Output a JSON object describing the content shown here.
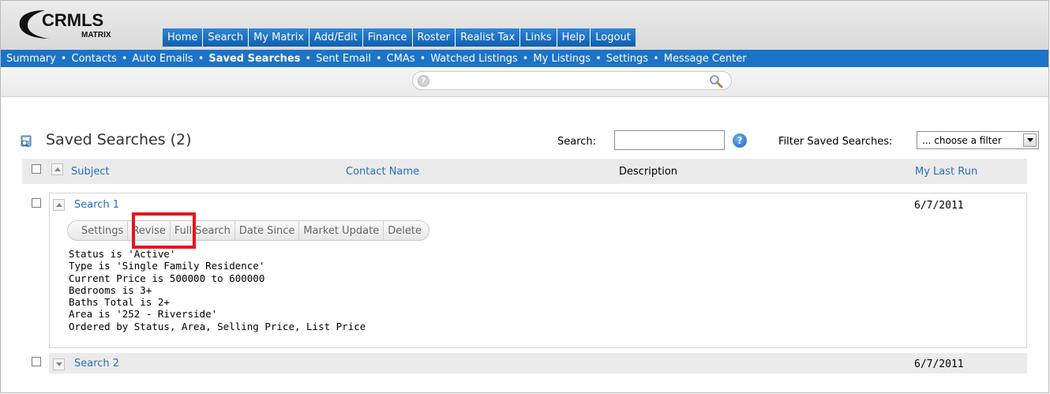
{
  "logo": {
    "text_top": "CRMLS",
    "text_bottom": "MATRIX"
  },
  "main_nav": [
    "Home",
    "Search",
    "My Matrix",
    "Add/Edit",
    "Finance",
    "Roster",
    "Realist Tax",
    "Links",
    "Help",
    "Logout"
  ],
  "sub_nav": [
    {
      "label": "Summary",
      "active": false
    },
    {
      "label": "Contacts",
      "active": false
    },
    {
      "label": "Auto Emails",
      "active": false
    },
    {
      "label": "Saved Searches",
      "active": true
    },
    {
      "label": "Sent Email",
      "active": false
    },
    {
      "label": "CMAs",
      "active": false
    },
    {
      "label": "Watched Listings",
      "active": false
    },
    {
      "label": "My Listings",
      "active": false
    },
    {
      "label": "Settings",
      "active": false
    },
    {
      "label": "Message Center",
      "active": false
    }
  ],
  "sub_nav_separator": "•",
  "quick_search": {
    "value": "",
    "help_glyph": "?"
  },
  "page": {
    "title": "Saved Searches (2)",
    "search_label": "Search:",
    "search_value": "",
    "help_glyph": "?",
    "filter_label": "Filter Saved Searches:",
    "filter_value": "... choose a filter"
  },
  "table": {
    "columns": {
      "subject": "Subject",
      "contact": "Contact Name",
      "description": "Description",
      "last_run": "My Last Run"
    },
    "rows": [
      {
        "title": "Search 1",
        "last_run": "6/7/2011",
        "expanded": true,
        "actions": [
          "Settings",
          "Revise",
          "Full Search",
          "Date Since",
          "Market Update",
          "Delete"
        ],
        "criteria": [
          "Status is 'Active'",
          "Type is 'Single Family Residence'",
          "Current Price is 500000 to 600000",
          "Bedrooms is 3+",
          "Baths Total is 2+",
          "Area is '252 - Riverside'",
          "Ordered by Status, Area, Selling Price, List Price"
        ]
      },
      {
        "title": "Search 2",
        "last_run": "6/7/2011",
        "expanded": false
      }
    ]
  },
  "colors": {
    "nav_blue": "#1d73c8",
    "link_blue": "#2a6ebb",
    "highlight_red": "#e8141b"
  }
}
